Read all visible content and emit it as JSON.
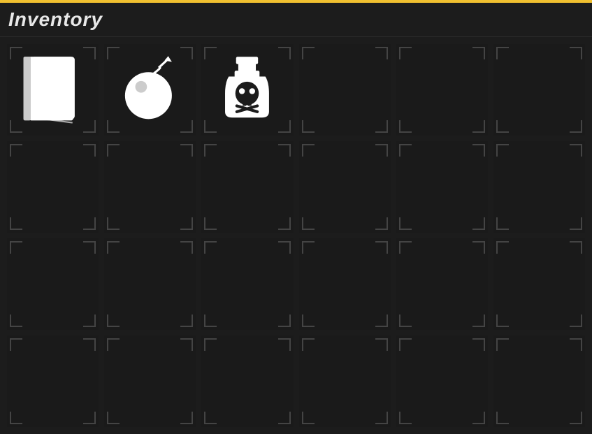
{
  "header": {
    "title": "Inventory"
  },
  "grid": {
    "rows": 4,
    "cols": 6,
    "slots": [
      {
        "id": 0,
        "icon": "book"
      },
      {
        "id": 1,
        "icon": "bomb"
      },
      {
        "id": 2,
        "icon": "poison"
      },
      {
        "id": 3,
        "icon": null
      },
      {
        "id": 4,
        "icon": null
      },
      {
        "id": 5,
        "icon": null
      },
      {
        "id": 6,
        "icon": null
      },
      {
        "id": 7,
        "icon": null
      },
      {
        "id": 8,
        "icon": null
      },
      {
        "id": 9,
        "icon": null
      },
      {
        "id": 10,
        "icon": null
      },
      {
        "id": 11,
        "icon": null
      },
      {
        "id": 12,
        "icon": null
      },
      {
        "id": 13,
        "icon": null
      },
      {
        "id": 14,
        "icon": null
      },
      {
        "id": 15,
        "icon": null
      },
      {
        "id": 16,
        "icon": null
      },
      {
        "id": 17,
        "icon": null
      },
      {
        "id": 18,
        "icon": null
      },
      {
        "id": 19,
        "icon": null
      },
      {
        "id": 20,
        "icon": null
      },
      {
        "id": 21,
        "icon": null
      },
      {
        "id": 22,
        "icon": null
      },
      {
        "id": 23,
        "icon": null
      }
    ]
  }
}
